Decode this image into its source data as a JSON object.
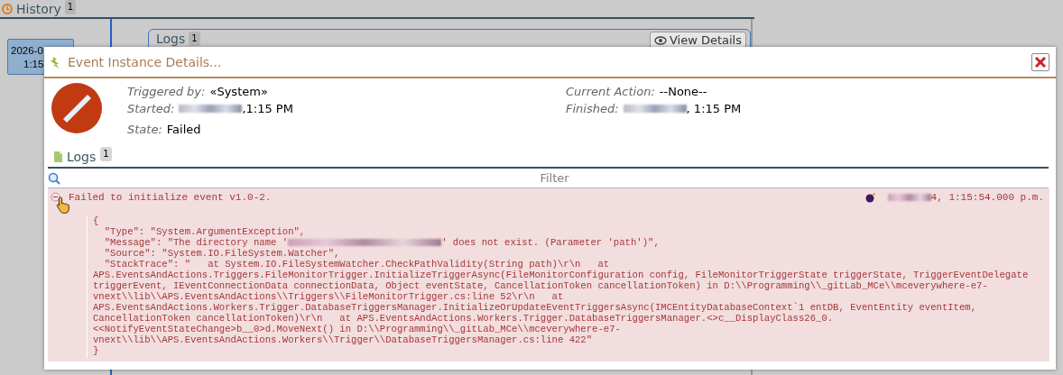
{
  "background": {
    "history_tab": {
      "label": "History",
      "count": "1"
    },
    "history_item": {
      "lines": [
        "2026-0",
        "1:15"
      ],
      "selected": true
    },
    "logs_panel": {
      "label": "Logs",
      "count": "1",
      "button": "View Details"
    }
  },
  "dialog": {
    "title": "Event Instance Details...",
    "kind": "failed",
    "left_fields": [
      {
        "label": "Triggered by:",
        "value": "«System»",
        "redacted": false
      },
      {
        "label": "Started:",
        "value": ",1:15 PM",
        "redacted": true
      },
      {
        "label": "State:",
        "value": "Failed",
        "redacted": false
      }
    ],
    "right_fields": [
      {
        "label": "Current Action:",
        "value": "--None--",
        "redacted": false
      },
      {
        "label": "Finished:",
        "value": ", 1:15 PM",
        "redacted": true
      }
    ],
    "logs": {
      "label": "Logs",
      "count": "1",
      "filter_placeholder": "Filter",
      "entries": [
        {
          "kind": "error",
          "expanded": true,
          "message": "Failed to initialize event v1.0-2.",
          "timestamp": "4, 1:15:54.000 p.m.",
          "timestamp_redacted": true,
          "detail_lines": [
            [
              {
                "kind": "text",
                "text": "{"
              }
            ],
            [
              {
                "kind": "text",
                "text": "  \"Type\": \"System.ArgumentException\","
              }
            ],
            [
              {
                "kind": "text",
                "text": "  \"Message\": \"The directory name '"
              },
              {
                "kind": "redaction"
              },
              {
                "kind": "text",
                "text": "' does not exist. (Parameter 'path')\","
              }
            ],
            [
              {
                "kind": "text",
                "text": "  \"Source\": \"System.IO.FileSystem.Watcher\","
              }
            ],
            [
              {
                "kind": "text",
                "text": "  \"StackTrace\": \"   at System.IO.FileSystemWatcher.CheckPathValidity(String path)\\r\\n   at"
              }
            ],
            [
              {
                "kind": "text",
                "text": "APS.EventsAndActions.Triggers.FileMonitorTrigger.InitializeTriggerAsync(FileMonitorConfiguration config, FileMonitorTriggerState triggerState, TriggerEventDelegate"
              }
            ],
            [
              {
                "kind": "text",
                "text": "triggerEvent, IEventConnectionData connectionData, Object eventState, CancellationToken cancellationToken) in D:\\\\Programming\\\\_gitLab_MCe\\\\mceverywhere-e7-"
              }
            ],
            [
              {
                "kind": "text",
                "text": "vnext\\\\lib\\\\APS.EventsAndActions\\\\Triggers\\\\FileMonitorTrigger.cs:line 52\\r\\n   at"
              }
            ],
            [
              {
                "kind": "text",
                "text": "APS.EventsAndActions.Workers.Trigger.DatabaseTriggersManager.InitializeOrUpdateEventTriggersAsync(IMCEntityDatabaseContext`1 entDB, EventEntity eventItem,"
              }
            ],
            [
              {
                "kind": "text",
                "text": "CancellationToken cancellationToken)\\r\\n   at APS.EventsAndActions.Workers.Trigger.DatabaseTriggersManager.<>c__DisplayClass26_0."
              }
            ],
            [
              {
                "kind": "text",
                "text": "<<NotifyEventStateChange>b__0>d.MoveNext() in D:\\\\Programming\\\\_gitLab_MCe\\\\mceverywhere-e7-"
              }
            ],
            [
              {
                "kind": "text",
                "text": "vnext\\\\lib\\\\APS.EventsAndActions.Workers\\\\Trigger\\\\DatabaseTriggersManager.cs:line 422\""
              }
            ],
            [
              {
                "kind": "text",
                "text": "}"
              }
            ]
          ]
        }
      ]
    }
  }
}
